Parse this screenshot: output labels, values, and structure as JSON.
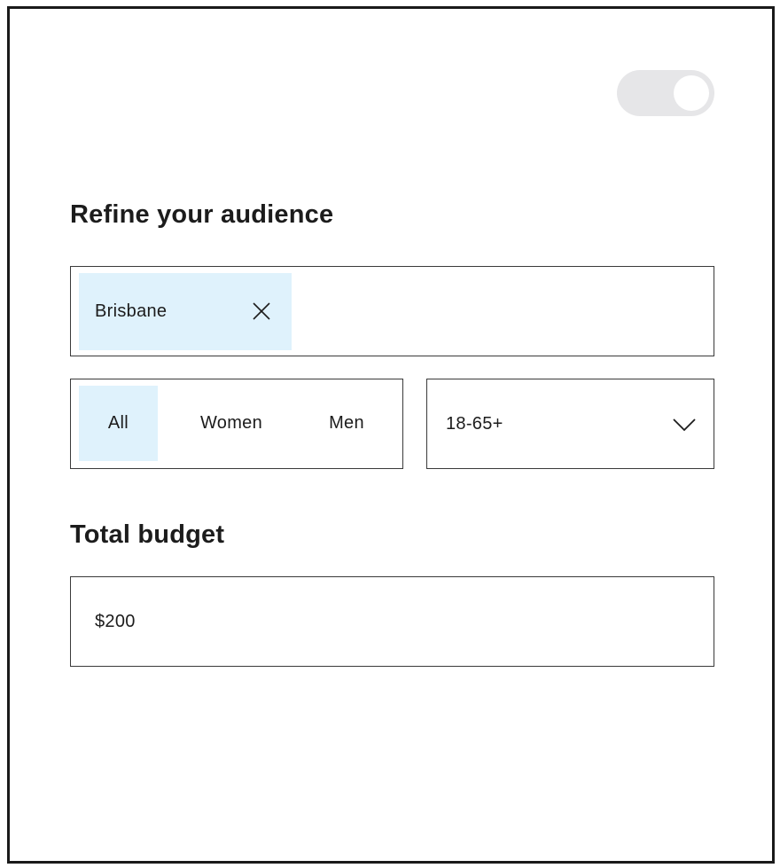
{
  "settings_toggle": {
    "state": "on"
  },
  "audience": {
    "title": "Refine your audience",
    "location_chips": [
      {
        "label": "Brisbane",
        "remove_icon": "close-icon"
      }
    ],
    "gender": {
      "options": [
        "All",
        "Women",
        "Men"
      ],
      "selected": "All"
    },
    "age_range": {
      "value": "18-65+",
      "icon": "chevron-down-icon"
    }
  },
  "budget": {
    "title": "Total budget",
    "value": "$200"
  },
  "colors": {
    "selected_background": "#dff2fc",
    "toggle_track": "#e6e6e8",
    "border": "#3a3a3a",
    "text": "#1c1c1c"
  }
}
